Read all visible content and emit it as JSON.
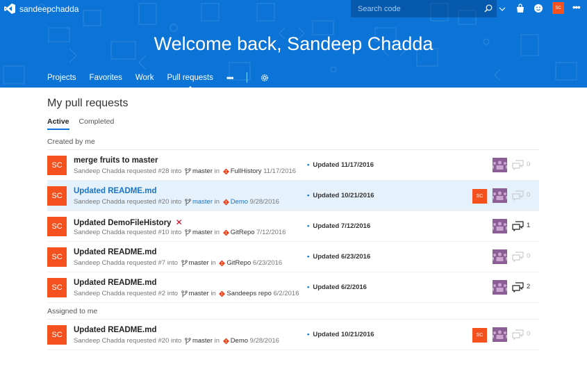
{
  "header": {
    "org_name": "sandeepchadda",
    "search_placeholder": "Search code",
    "user_initials": "SC",
    "more_label": "•••",
    "welcome": "Welcome back, Sandeep Chadda"
  },
  "nav": {
    "items": [
      {
        "label": "Projects",
        "active": false
      },
      {
        "label": "Favorites",
        "active": false
      },
      {
        "label": "Work",
        "active": false
      },
      {
        "label": "Pull requests",
        "active": true
      }
    ],
    "more_label": "•••"
  },
  "page": {
    "title": "My pull requests",
    "tabs": [
      {
        "label": "Active",
        "active": true
      },
      {
        "label": "Completed",
        "active": false
      }
    ]
  },
  "sections": [
    {
      "label": "Created by me",
      "rows": [
        {
          "initials": "SC",
          "title": "merge fruits to master",
          "failed": false,
          "author": "Sandeep Chadda",
          "pr_text": "requested #28 into",
          "branch": "master",
          "in_text": "in",
          "repo": "FullHistory",
          "date": "11/17/2016",
          "updated": "Updated 11/17/2016",
          "self_reviewer": false,
          "comments": "0",
          "selected": false
        },
        {
          "initials": "SC",
          "title": "Updated README.md",
          "failed": false,
          "author": "Sandeep Chadda",
          "pr_text": "requested #20 into",
          "branch": "master",
          "in_text": "in",
          "repo": "Demo",
          "date": "9/28/2016",
          "updated": "Updated 10/21/2016",
          "self_reviewer": true,
          "comments": "0",
          "selected": true
        },
        {
          "initials": "SC",
          "title": "Updated DemoFileHistory",
          "failed": true,
          "author": "Sandeep Chadda",
          "pr_text": "requested #10 into",
          "branch": "master",
          "in_text": "in",
          "repo": "GitRepo",
          "date": "7/12/2016",
          "updated": "Updated 7/12/2016",
          "self_reviewer": false,
          "comments": "1",
          "selected": false
        },
        {
          "initials": "SC",
          "title": "Updated README.md",
          "failed": false,
          "author": "Sandeep Chadda",
          "pr_text": "requested #7 into",
          "branch": "master",
          "in_text": "in",
          "repo": "GitRepo",
          "date": "6/23/2016",
          "updated": "Updated 6/23/2016",
          "self_reviewer": false,
          "comments": "0",
          "selected": false
        },
        {
          "initials": "SC",
          "title": "Updated README.md",
          "failed": false,
          "author": "Sandeep Chadda",
          "pr_text": "requested #2 into",
          "branch": "master",
          "in_text": "in",
          "repo": "Sandeeps repo",
          "date": "6/2/2016",
          "updated": "Updated 6/2/2016",
          "self_reviewer": false,
          "comments": "2",
          "selected": false
        }
      ]
    },
    {
      "label": "Assigned to me",
      "rows": [
        {
          "initials": "SC",
          "title": "Updated README.md",
          "failed": false,
          "author": "Sandeep Chadda",
          "pr_text": "requested #20 into",
          "branch": "master",
          "in_text": "in",
          "repo": "Demo",
          "date": "9/28/2016",
          "updated": "Updated 10/21/2016",
          "self_reviewer": true,
          "comments": "0",
          "selected": false
        }
      ]
    }
  ],
  "colors": {
    "brand_blue": "#0b74d6",
    "avatar_orange": "#f4511e",
    "team_purple": "#8b5f96",
    "failed_red": "#d0021b",
    "selected_row": "#e6f2fb"
  }
}
